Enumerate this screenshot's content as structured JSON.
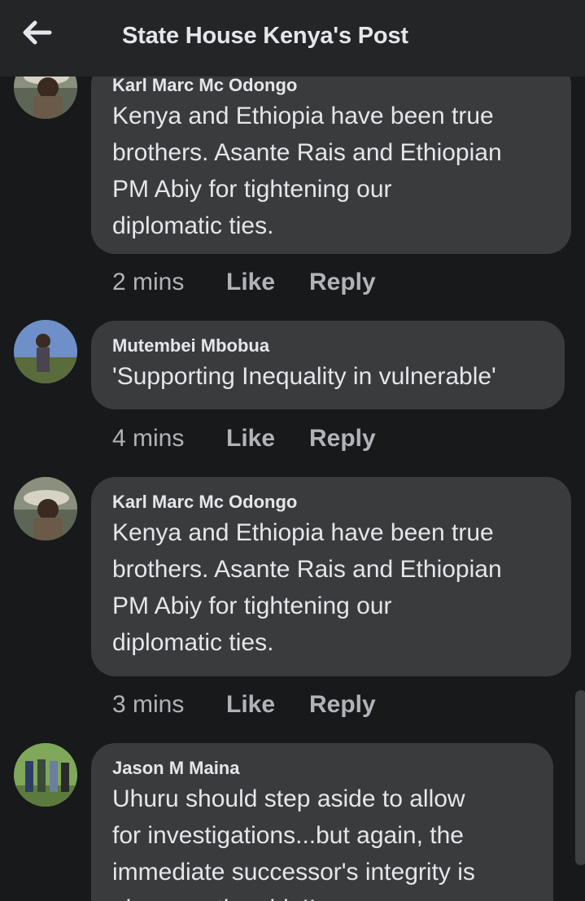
{
  "header": {
    "title": "State House Kenya's Post",
    "back_icon": "arrow-left-icon"
  },
  "colors": {
    "background": "#18191a",
    "header": "#242526",
    "bubble": "#3a3b3c",
    "primary_text": "#e4e6eb",
    "secondary_text": "#b0b3b8"
  },
  "comments": [
    {
      "author": "Karl Marc Mc Odongo",
      "text": "Kenya and Ethiopia have been true\nbrothers. Asante Rais and Ethiopian\nPM Abiy for tightening our\ndiplomatic ties.",
      "time": "2 mins",
      "like_label": "Like",
      "reply_label": "Reply"
    },
    {
      "author": "Mutembei Mbobua",
      "text": "'Supporting Inequality in vulnerable'",
      "time": "4 mins",
      "like_label": "Like",
      "reply_label": "Reply"
    },
    {
      "author": "Karl Marc Mc Odongo",
      "text": "Kenya and Ethiopia have been true\nbrothers. Asante Rais and Ethiopian\nPM Abiy for tightening our\ndiplomatic ties.",
      "time": "3 mins",
      "like_label": "Like",
      "reply_label": "Reply"
    },
    {
      "author": "Jason M Maina",
      "text": "Uhuru should step aside to allow\nfor investigations...but again, the\nimmediate successor's integrity is\nalso questionable!!"
    }
  ]
}
